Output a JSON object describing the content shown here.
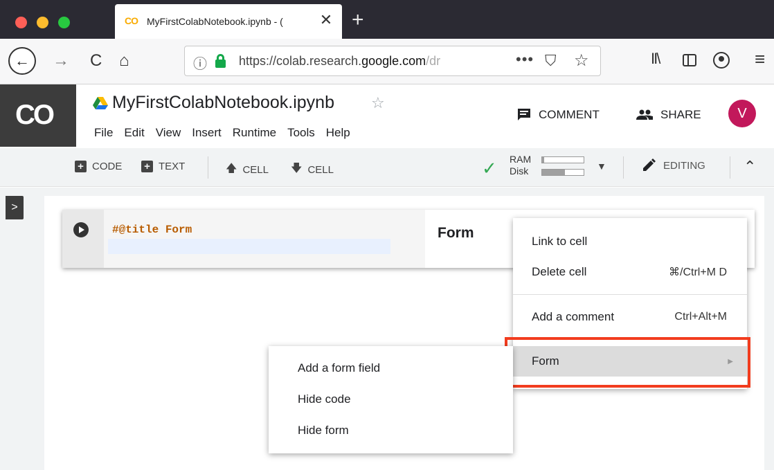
{
  "browser": {
    "tab": {
      "favicon": "CO",
      "title": "MyFirstColabNotebook.ipynb - (",
      "close": "✕"
    },
    "new_tab": "+",
    "nav": {
      "back": "←",
      "forward": "→",
      "reload": "C",
      "home": "⌂"
    },
    "url": {
      "info_icon": "ⓘ",
      "prefix": "https://colab.research.",
      "host": "google.com",
      "path": "/dr",
      "more": "•••",
      "pocket": "⛉",
      "star": "☆"
    },
    "toolbar_icons": {
      "library": "II\\",
      "hamburger": "≡"
    }
  },
  "colab": {
    "logo": "CO",
    "notebook_title": "MyFirstColabNotebook.ipynb",
    "star": "☆",
    "menu": [
      "File",
      "Edit",
      "View",
      "Insert",
      "Runtime",
      "Tools",
      "Help"
    ],
    "comment_label": "COMMENT",
    "share_label": "SHARE",
    "avatar_letter": "V",
    "toolbar": {
      "code_label": "CODE",
      "text_label": "TEXT",
      "cell_up_label": "CELL",
      "cell_down_label": "CELL",
      "ram_label": "RAM",
      "disk_label": "Disk",
      "ram_fraction": 0.05,
      "disk_fraction": 0.55,
      "editing_label": "EDITING"
    },
    "sidebar_toggle": ">",
    "cell": {
      "code": "#@title Form",
      "form_title": "Form"
    }
  },
  "context_menu": {
    "items": [
      {
        "label": "Link to cell",
        "shortcut": ""
      },
      {
        "label": "Delete cell",
        "shortcut": "⌘/Ctrl+M D"
      },
      {
        "label": "Add a comment",
        "shortcut": "Ctrl+Alt+M"
      },
      {
        "label": "Form",
        "shortcut": "▶"
      }
    ]
  },
  "submenu": {
    "items": [
      "Add a form field",
      "Hide code",
      "Hide form"
    ]
  },
  "colors": {
    "highlight": "#f23c1e",
    "avatar": "#c2185b",
    "check": "#34a853",
    "code_keyword": "#b85c00"
  }
}
